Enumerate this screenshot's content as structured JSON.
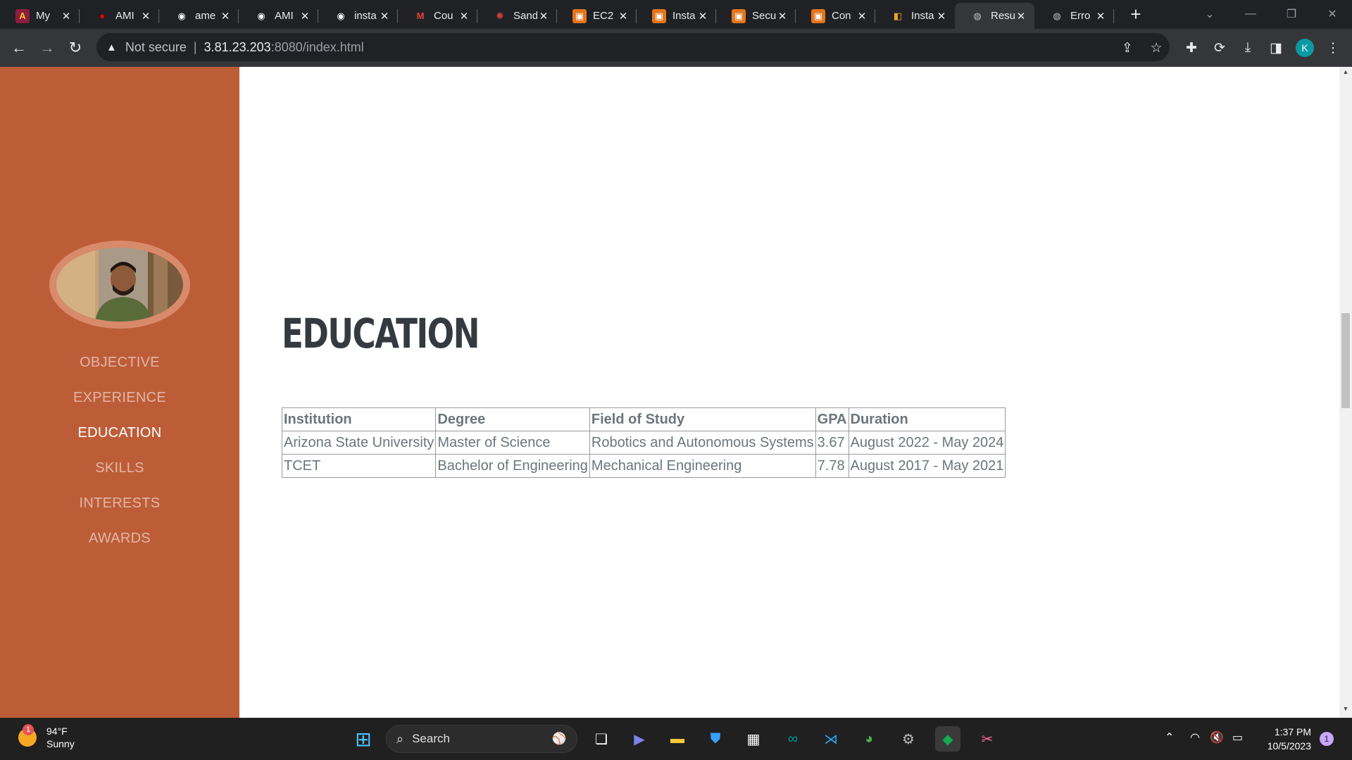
{
  "browser": {
    "tabs": [
      {
        "title": "My",
        "icon": "asu-icon",
        "icon_glyph": "A",
        "icon_bg": "#8c1d40",
        "icon_fg": "#ffc627"
      },
      {
        "title": "AMI",
        "icon": "redhat-icon",
        "icon_glyph": "●",
        "icon_bg": "transparent",
        "icon_fg": "#e00"
      },
      {
        "title": "ame",
        "icon": "github-icon",
        "icon_glyph": "◉",
        "icon_bg": "transparent",
        "icon_fg": "#fff"
      },
      {
        "title": "AMI",
        "icon": "github-icon",
        "icon_glyph": "◉",
        "icon_bg": "transparent",
        "icon_fg": "#fff"
      },
      {
        "title": "insta",
        "icon": "github-icon",
        "icon_glyph": "◉",
        "icon_bg": "transparent",
        "icon_fg": "#fff"
      },
      {
        "title": "Cou",
        "icon": "gmail-icon",
        "icon_glyph": "M",
        "icon_bg": "transparent",
        "icon_fg": "#ea4335"
      },
      {
        "title": "Sand",
        "icon": "sandbox-icon",
        "icon_glyph": "✺",
        "icon_bg": "transparent",
        "icon_fg": "#e0403a"
      },
      {
        "title": "EC2",
        "icon": "aws-ec2-icon",
        "icon_glyph": "▣",
        "icon_bg": "#e4751b",
        "icon_fg": "#fff"
      },
      {
        "title": "Insta",
        "icon": "aws-ec2-icon",
        "icon_glyph": "▣",
        "icon_bg": "#e4751b",
        "icon_fg": "#fff"
      },
      {
        "title": "Secu",
        "icon": "aws-ec2-icon",
        "icon_glyph": "▣",
        "icon_bg": "#e4751b",
        "icon_fg": "#fff"
      },
      {
        "title": "Con",
        "icon": "aws-ec2-icon",
        "icon_glyph": "▣",
        "icon_bg": "#e4751b",
        "icon_fg": "#fff"
      },
      {
        "title": "Insta",
        "icon": "aws-package-icon",
        "icon_glyph": "◧",
        "icon_bg": "transparent",
        "icon_fg": "#f5a623"
      },
      {
        "title": "Resu",
        "icon": "globe-icon",
        "icon_glyph": "◍",
        "icon_bg": "transparent",
        "icon_fg": "#bdc1c6",
        "active": true
      },
      {
        "title": "Erro",
        "icon": "globe-icon",
        "icon_glyph": "◍",
        "icon_bg": "transparent",
        "icon_fg": "#bdc1c6"
      }
    ],
    "address": {
      "security_label": "Not secure",
      "host": "3.81.23.203",
      "path": ":8080/index.html"
    },
    "profile_initial": "K"
  },
  "sidebar": {
    "nav": [
      {
        "label": "OBJECTIVE",
        "active": false
      },
      {
        "label": "EXPERIENCE",
        "active": false
      },
      {
        "label": "EDUCATION",
        "active": true
      },
      {
        "label": "SKILLS",
        "active": false
      },
      {
        "label": "INTERESTS",
        "active": false
      },
      {
        "label": "AWARDS",
        "active": false
      }
    ],
    "accent_color": "#bd5d38"
  },
  "education": {
    "heading": "EDUCATION",
    "columns": [
      "Institution",
      "Degree",
      "Field of Study",
      "GPA",
      "Duration"
    ],
    "rows": [
      [
        "Arizona State University",
        "Master of Science",
        "Robotics and Autonomous Systems",
        "3.67",
        "August 2022 - May 2024"
      ],
      [
        "TCET",
        "Bachelor of Engineering",
        "Mechanical Engineering",
        "7.78",
        "August 2017 - May 2021"
      ]
    ]
  },
  "taskbar": {
    "weather": {
      "temp": "94°F",
      "condition": "Sunny",
      "badge": "1"
    },
    "search_placeholder": "Search",
    "time": "1:37 PM",
    "date": "10/5/2023",
    "notifications": "1"
  }
}
